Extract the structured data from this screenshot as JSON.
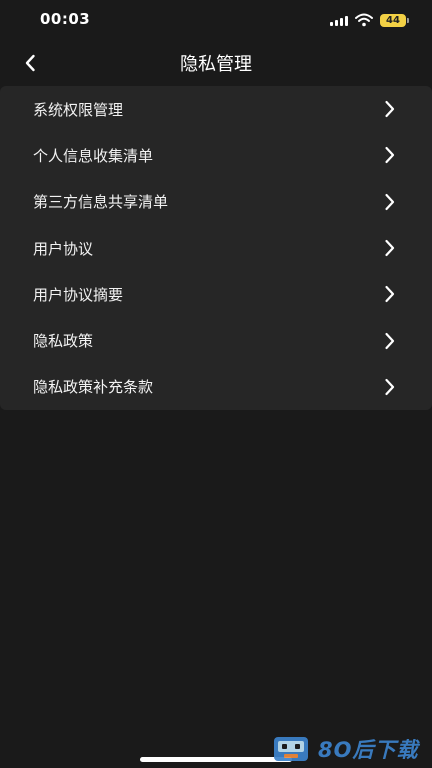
{
  "status_bar": {
    "time": "00:03",
    "battery": "44"
  },
  "nav": {
    "title": "隐私管理",
    "back_icon": "chevron-left-icon"
  },
  "menu": {
    "items": [
      {
        "label": "系统权限管理"
      },
      {
        "label": "个人信息收集清单"
      },
      {
        "label": "第三方信息共享清单"
      },
      {
        "label": "用户协议"
      },
      {
        "label": "用户协议摘要"
      },
      {
        "label": "隐私政策"
      },
      {
        "label": "隐私政策补充条款"
      }
    ],
    "item_icon": "chevron-right-icon"
  },
  "watermark": {
    "text": "8O后下载"
  },
  "colors": {
    "background": "#1a1a1a",
    "list_background": "#262626",
    "battery": "#f3d145",
    "watermark_blue": "#3c83cc"
  }
}
